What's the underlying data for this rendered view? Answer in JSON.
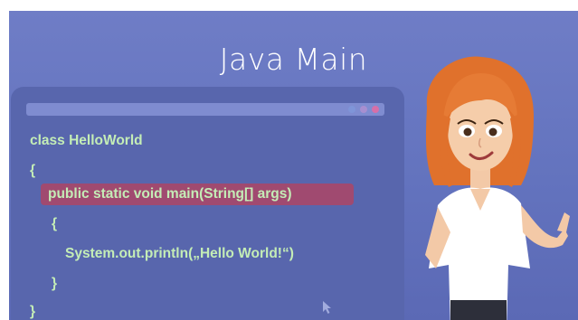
{
  "title": "Java Main",
  "code_lines": [
    "class HelloWorld",
    "{",
    "public static void main(String[] args)",
    "{",
    "System.out.println(„Hello World!“)",
    "}",
    "}"
  ],
  "colors": {
    "background": "#6373be",
    "code_text": "#c4edb6",
    "highlight": "#a04a70",
    "window_dots": [
      "#7f95d8",
      "#a78fd0",
      "#d66fa8"
    ]
  },
  "icons": [
    "mouse-cursor-icon",
    "character-illustration"
  ]
}
